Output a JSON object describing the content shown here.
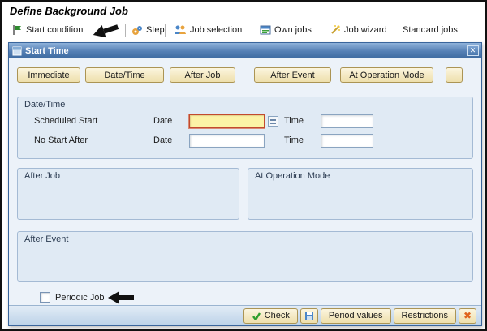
{
  "page": {
    "title": "Define Background Job"
  },
  "toolbar": {
    "start_condition": "Start condition",
    "step": "Step",
    "job_selection": "Job selection",
    "own_jobs": "Own jobs",
    "job_wizard": "Job wizard",
    "standard_jobs": "Standard jobs"
  },
  "dialog": {
    "title": "Start Time",
    "buttons": {
      "immediate": "Immediate",
      "date_time": "Date/Time",
      "after_job": "After Job",
      "after_event": "After Event",
      "at_operation_mode": "At Operation Mode",
      "extra": ""
    },
    "groups": {
      "date_time": {
        "title": "Date/Time",
        "scheduled_start": "Scheduled Start",
        "no_start_after": "No Start After",
        "date_label": "Date",
        "time_label": "Time"
      },
      "after_job": {
        "title": "After Job"
      },
      "at_operation_mode": {
        "title": "At Operation Mode"
      },
      "after_event": {
        "title": "After Event"
      }
    },
    "fields": {
      "scheduled_start_date": "",
      "scheduled_start_time": "",
      "no_start_after_date": "",
      "no_start_after_time": ""
    },
    "periodic_job": {
      "label": "Periodic Job",
      "checked": false
    },
    "footer": {
      "check": "Check",
      "period_values": "Period values",
      "restrictions": "Restrictions"
    }
  },
  "icons": {
    "start_condition": "flag-icon",
    "step": "gear-icon",
    "job_selection": "people-icon",
    "own_jobs": "monitor-list-icon",
    "job_wizard": "wand-icon",
    "dialog": "window-icon",
    "close": "close-icon",
    "check": "check-icon",
    "save": "save-icon",
    "cancel": "cancel-x-icon"
  },
  "colors": {
    "titlebar_blue": "#547fb4",
    "button_tan": "#eedfac",
    "focus_field_yellow": "#fcf3a6",
    "focus_border_red": "#c24a2e",
    "annotation_arrow": "#111111"
  }
}
